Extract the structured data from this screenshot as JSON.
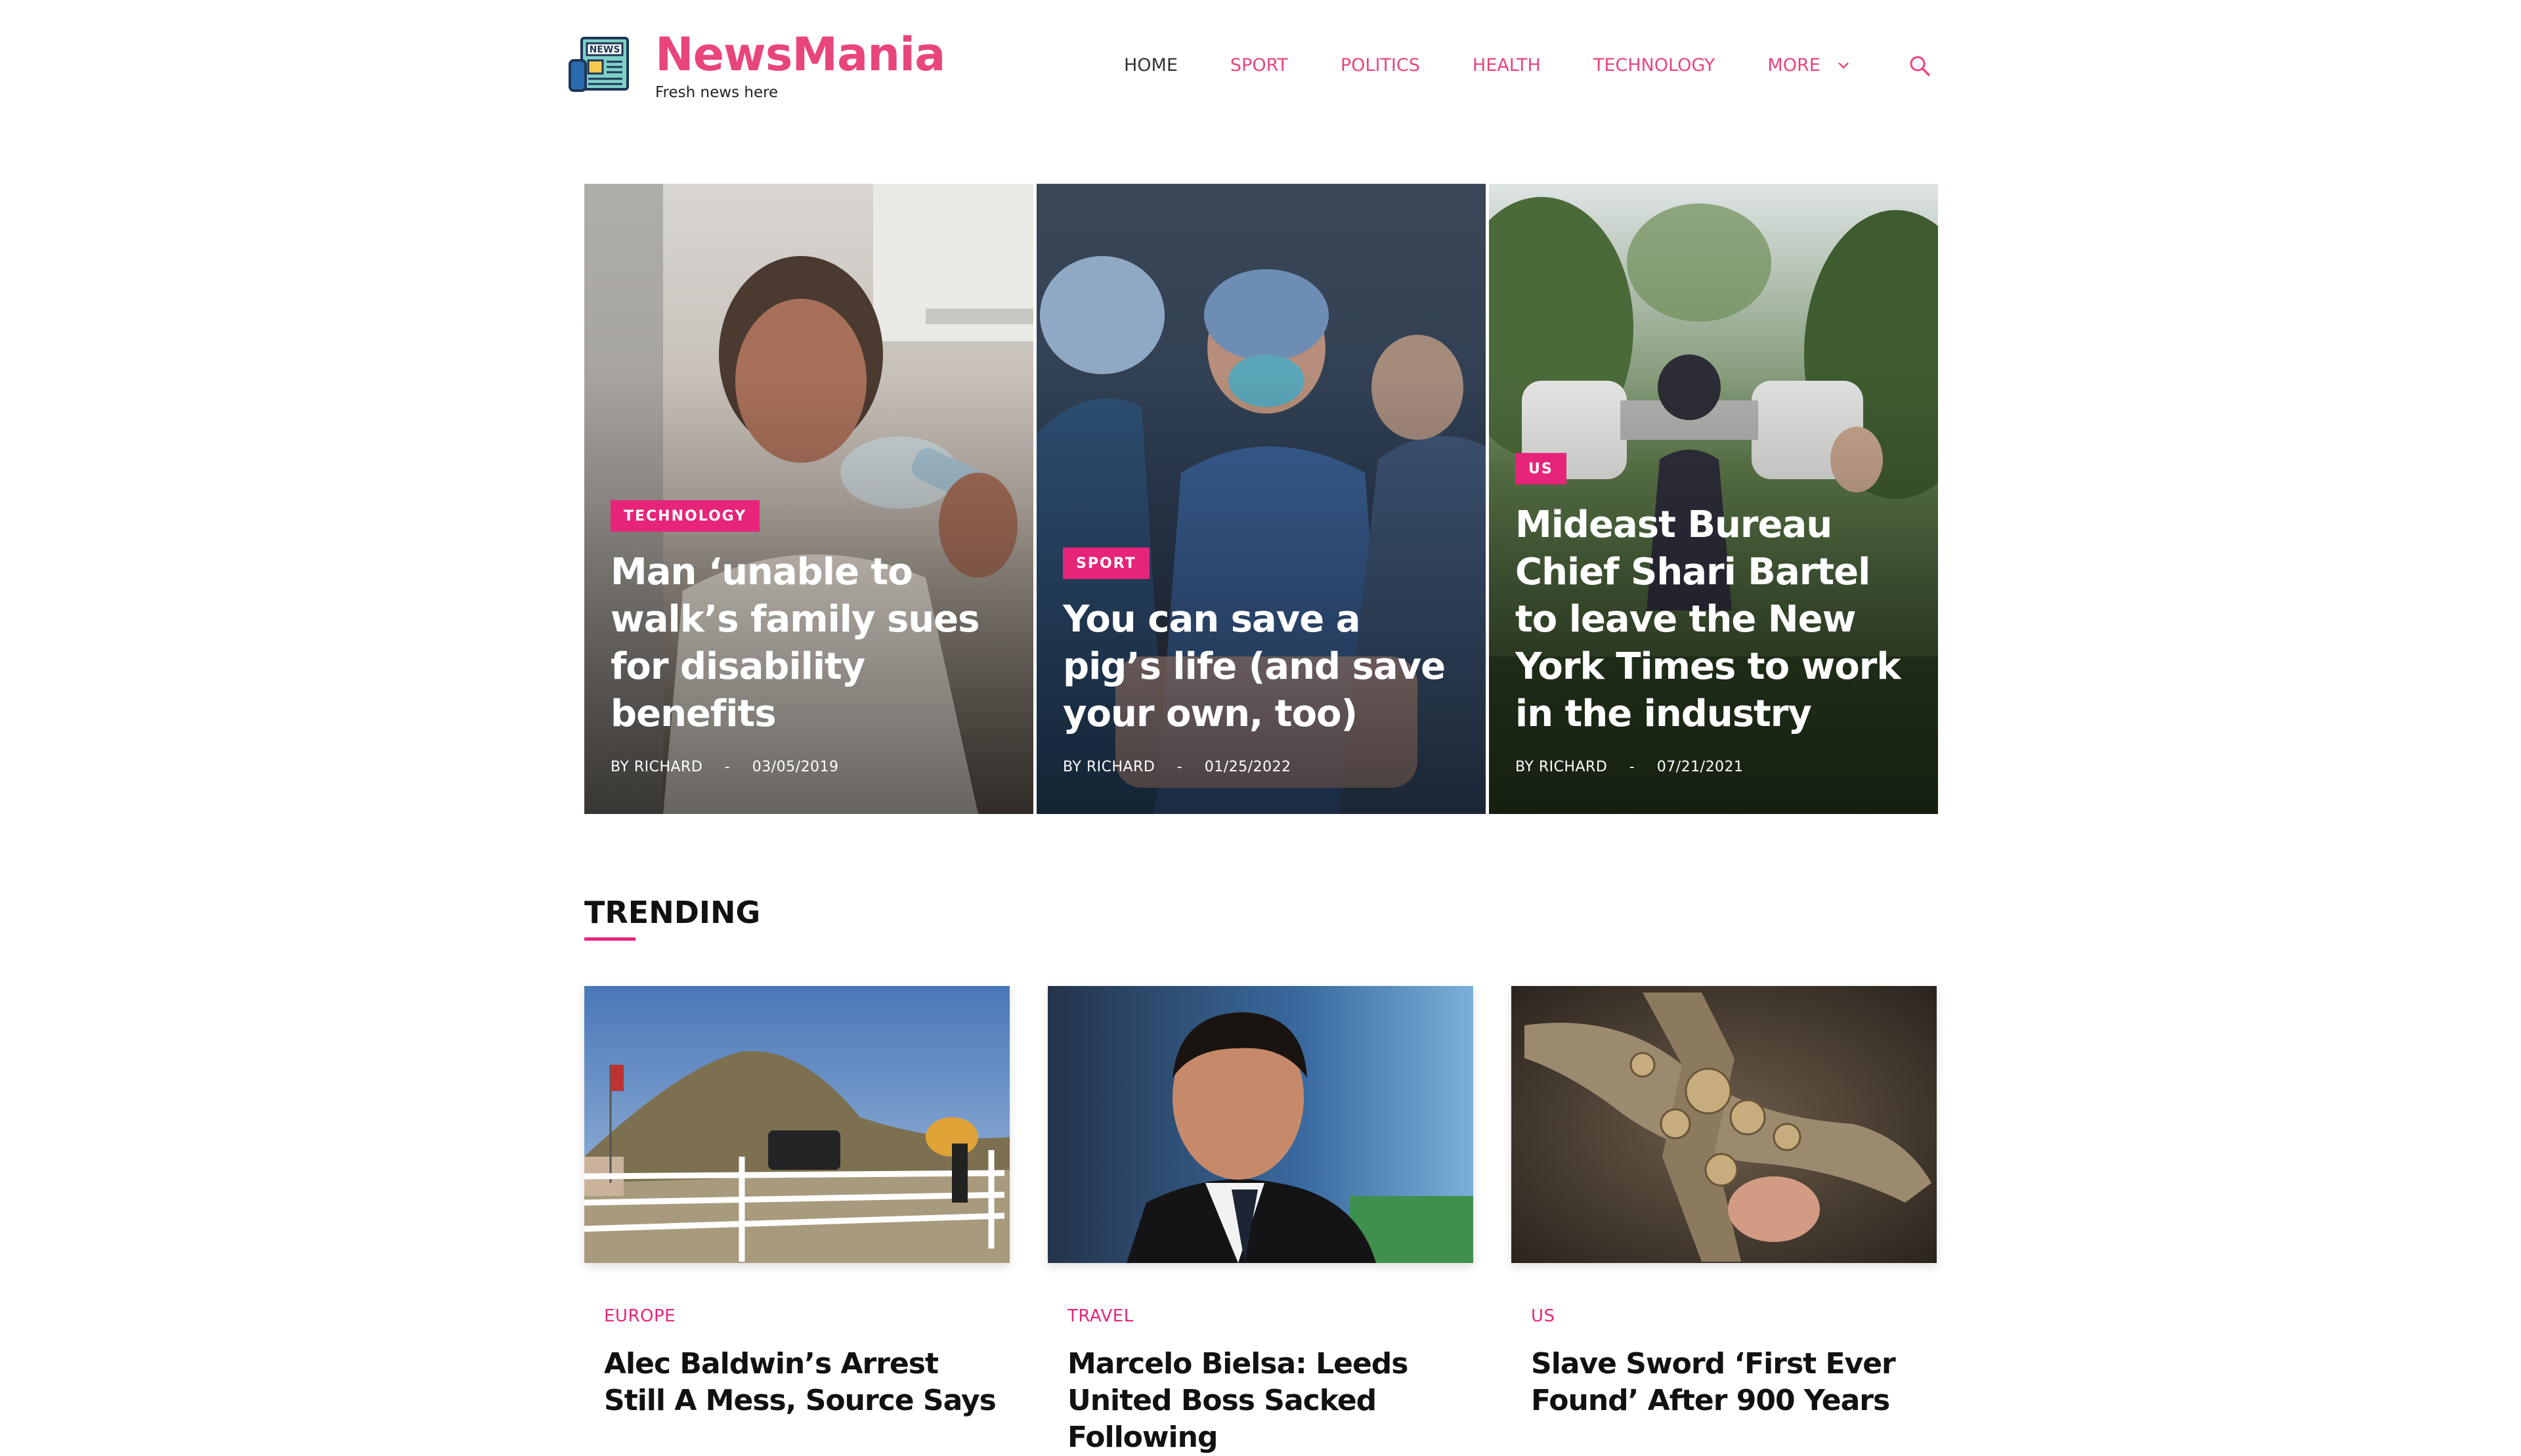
{
  "brand": {
    "title": "NewsMania",
    "tagline": "Fresh news here",
    "logo_icon": "newspaper-icon",
    "accent_color": "#e8457b"
  },
  "nav": {
    "items": [
      {
        "label": "HOME"
      },
      {
        "label": "SPORT"
      },
      {
        "label": "POLITICS"
      },
      {
        "label": "HEALTH"
      },
      {
        "label": "TECHNOLOGY"
      },
      {
        "label": "MORE"
      }
    ],
    "more_icon": "chevron-down-icon",
    "search_icon": "search-icon"
  },
  "hero": {
    "badge_color": "#e6257a",
    "cards": [
      {
        "category": "TECHNOLOGY",
        "title": "Man ‘unable to walk’s family sues for disability benefits",
        "by": "BY",
        "author": "RICHARD",
        "separator": "-",
        "date": "03/05/2019"
      },
      {
        "category": "SPORT",
        "title": "You can save a pig’s life (and save your own, too)",
        "by": "BY",
        "author": "RICHARD",
        "separator": "-",
        "date": "01/25/2022"
      },
      {
        "category": "US",
        "title": "Mideast Bureau Chief Shari Bartel to leave the New York Times to work in the industry",
        "by": "BY",
        "author": "RICHARD",
        "separator": "-",
        "date": "07/21/2021"
      }
    ]
  },
  "trending": {
    "title": "TRENDING",
    "cards": [
      {
        "category": "EUROPE",
        "title": "Alec Baldwin’s Arrest Still A Mess, Source Says"
      },
      {
        "category": "TRAVEL",
        "title": "Marcelo Bielsa: Leeds United Boss Sacked Following"
      },
      {
        "category": "US",
        "title": "Slave Sword ‘First Ever Found’ After 900 Years"
      }
    ]
  }
}
